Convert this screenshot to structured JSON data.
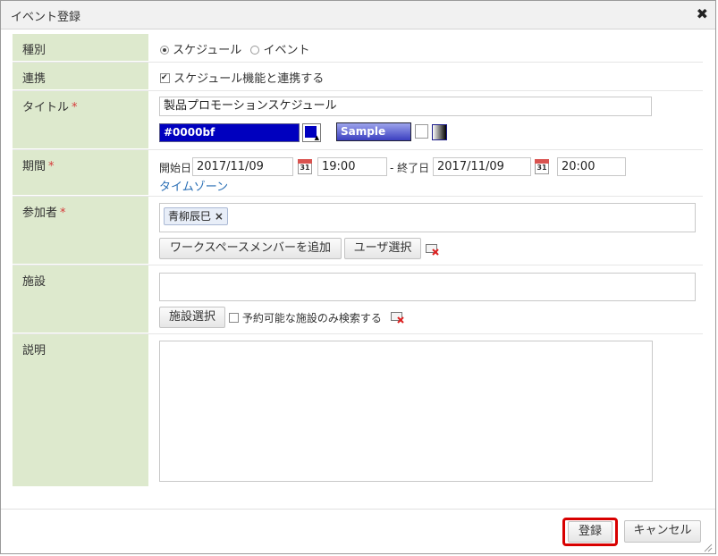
{
  "dialog": {
    "title": "イベント登録",
    "close_symbol": "✖"
  },
  "rows": {
    "type": {
      "label": "種別",
      "options": [
        {
          "label": "スケジュール",
          "selected": true
        },
        {
          "label": "イベント",
          "selected": false
        }
      ]
    },
    "link": {
      "label": "連携",
      "checkbox_label": "スケジュール機能と連携する",
      "checked": true
    },
    "title": {
      "label": "タイトル",
      "required_mark": "*",
      "value": "製品プロモーションスケジュール",
      "color_value": "#0000bf",
      "sample_label": "Sample"
    },
    "period": {
      "label": "期間",
      "required_mark": "*",
      "start_label": "開始日",
      "start_date": "2017/11/09",
      "start_time": "19:00",
      "end_label": "- 終了日",
      "end_date": "2017/11/09",
      "end_time": "20:00",
      "calendar_day": "31",
      "timezone_link": "タイムゾーン"
    },
    "participants": {
      "label": "参加者",
      "required_mark": "*",
      "tags": [
        {
          "name": "青柳辰巳",
          "remove": "×"
        }
      ],
      "add_members_button": "ワークスペースメンバーを追加",
      "select_user_button": "ユーザ選択"
    },
    "facility": {
      "label": "施設",
      "value": "",
      "select_button": "施設選択",
      "checkbox_label": "予約可能な施設のみ検索する",
      "checked": false
    },
    "description": {
      "label": "説明",
      "value": ""
    }
  },
  "footer": {
    "register_button": "登録",
    "cancel_button": "キャンセル"
  },
  "colors": {
    "label_bg": "#dde9cd",
    "color_chip": "#0000bf",
    "highlight_border": "#d80000",
    "required": "#d63a3a",
    "link": "#2a6fb5"
  }
}
